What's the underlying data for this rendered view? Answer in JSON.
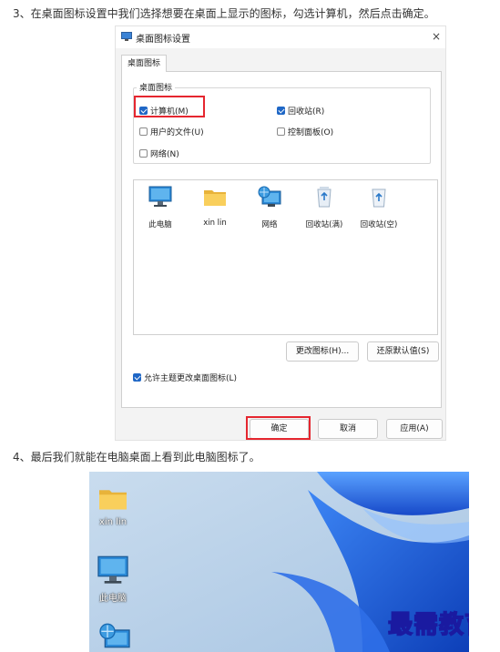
{
  "steps": {
    "step3": "3、在桌面图标设置中我们选择想要在桌面上显示的图标，勾选计算机，然后点击确定。",
    "step4": "4、最后我们就能在电脑桌面上看到此电脑图标了。"
  },
  "dialog": {
    "title": "桌面图标设置",
    "close": "×",
    "tab": "桌面图标",
    "group_label": "桌面图标",
    "checkboxes": [
      {
        "label": "计算机(M)",
        "checked": true
      },
      {
        "label": "回收站(R)",
        "checked": true
      },
      {
        "label": "用户的文件(U)",
        "checked": false
      },
      {
        "label": "控制面板(O)",
        "checked": false
      },
      {
        "label": "网络(N)",
        "checked": false
      }
    ],
    "icons": [
      {
        "label": "此电脑",
        "icon": "monitor-icon"
      },
      {
        "label": "xin lin",
        "icon": "folder-icon"
      },
      {
        "label": "网络",
        "icon": "network-icon"
      },
      {
        "label": "回收站(满)",
        "icon": "recycle-bin-full-icon"
      },
      {
        "label": "回收站(空)",
        "icon": "recycle-bin-empty-icon"
      }
    ],
    "change_icon": "更改图标(H)...",
    "restore_default": "还原默认值(S)",
    "allow_themes": {
      "label": "允许主题更改桌面图标(L)",
      "checked": true
    },
    "ok": "确定",
    "cancel": "取消",
    "apply": "应用(A)"
  },
  "desktop": {
    "icons": [
      {
        "label": "xin lin",
        "icon": "folder-icon"
      },
      {
        "label": "此电脑",
        "icon": "monitor-icon"
      },
      {
        "label": "",
        "icon": "network-icon"
      }
    ],
    "watermark": "最需教育"
  },
  "colors": {
    "accent": "#1f67c6",
    "highlight": "#e5262f",
    "wallpaper": "#b9d2ea",
    "bloom": "#1c5fe6"
  }
}
